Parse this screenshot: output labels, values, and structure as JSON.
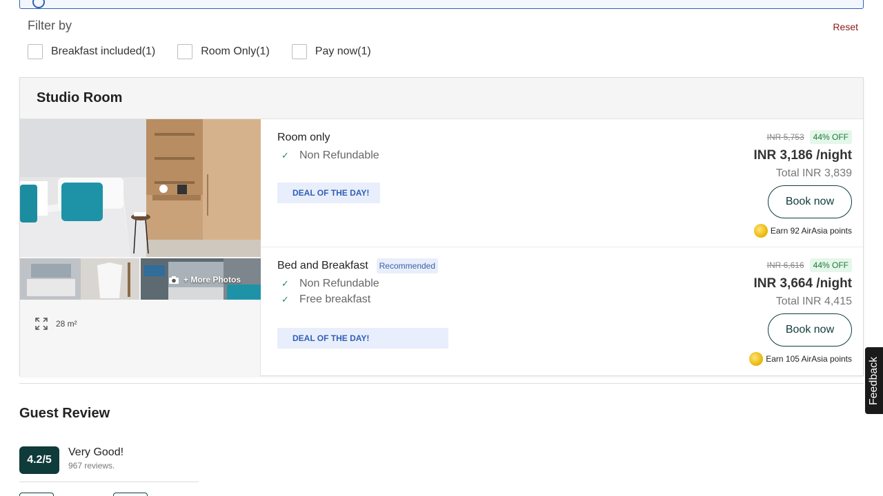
{
  "filter": {
    "title": "Filter by",
    "reset_label": "Reset",
    "options": [
      {
        "label": "Breakfast included(1)",
        "checked": false
      },
      {
        "label": "Room Only(1)",
        "checked": false
      },
      {
        "label": "Pay now(1)",
        "checked": false
      }
    ]
  },
  "room": {
    "title": "Studio Room",
    "more_photos_label": "+ More Photos",
    "size": "28 m²",
    "rates": [
      {
        "name": "Room only",
        "badge": "",
        "features": [
          "Non Refundable"
        ],
        "deal_label": "DEAL OF THE DAY!",
        "old_price": "INR 5,753",
        "discount": "44% OFF",
        "price": "INR 3,186",
        "per_night": "/night",
        "total": "Total INR 3,839",
        "book_label": "Book now",
        "points": "Earn 92 AirAsia points"
      },
      {
        "name": "Bed and Breakfast",
        "badge": "Recommended",
        "features": [
          "Non Refundable",
          "Free breakfast"
        ],
        "deal_label": "DEAL OF THE DAY!",
        "old_price": "INR 6,616",
        "discount": "44% OFF",
        "price": "INR 3,664",
        "per_night": "/night",
        "total": "Total INR 4,415",
        "book_label": "Book now",
        "points": "Earn 105 AirAsia points"
      }
    ]
  },
  "review": {
    "title": "Guest Review",
    "score": "4.2/5",
    "rating_label": "Very Good!",
    "count": "967 reviews."
  },
  "feedback_label": "Feedback",
  "colors": {
    "primary": "#0f3b3a",
    "reset": "#8b1a1a",
    "deal_bg": "#e8eefb",
    "deal_text": "#2f5fb5",
    "discount_bg": "#e5f6ea",
    "discount_text": "#1e7a35",
    "check": "#1c8a5a"
  },
  "icons": {
    "info": "info-icon",
    "camera": "camera-icon",
    "expand": "expand-icon",
    "check": "check-icon",
    "coin": "airasia-coin-icon"
  }
}
